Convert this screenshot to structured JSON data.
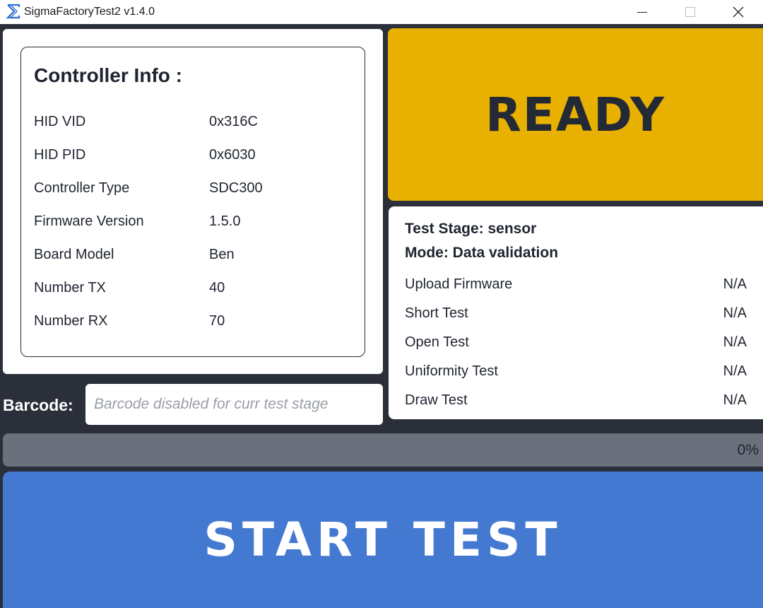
{
  "window": {
    "title": "SigmaFactoryTest2 v1.4.0",
    "minimize_glyph": "—",
    "maximize_glyph": "☐",
    "close_glyph": "✕",
    "icon": "sigma-app-icon"
  },
  "controller_info": {
    "title": "Controller Info :",
    "rows": [
      {
        "label": "HID VID",
        "value": "0x316C"
      },
      {
        "label": "HID PID",
        "value": "0x6030"
      },
      {
        "label": "Controller Type",
        "value": "SDC300"
      },
      {
        "label": "Firmware Version",
        "value": "1.5.0"
      },
      {
        "label": "Board Model",
        "value": "Ben"
      },
      {
        "label": "Number TX",
        "value": "40"
      },
      {
        "label": "Number RX",
        "value": "70"
      }
    ]
  },
  "status": {
    "text": "READY",
    "color": "#e8b000"
  },
  "test_stage": {
    "stage_line": "Test Stage: sensor",
    "mode_line": "Mode: Data validation",
    "tests": [
      {
        "name": "Upload Firmware",
        "result": "N/A"
      },
      {
        "name": "Short Test",
        "result": "N/A"
      },
      {
        "name": "Open Test",
        "result": "N/A"
      },
      {
        "name": "Uniformity Test",
        "result": "N/A"
      },
      {
        "name": "Draw Test",
        "result": "N/A"
      }
    ]
  },
  "barcode": {
    "label": "Barcode:",
    "value": "",
    "placeholder": "Barcode disabled for curr test stage"
  },
  "progress": {
    "percent": 0,
    "text": "0%"
  },
  "start_button": {
    "label": "START TEST",
    "color": "#4479d1"
  }
}
